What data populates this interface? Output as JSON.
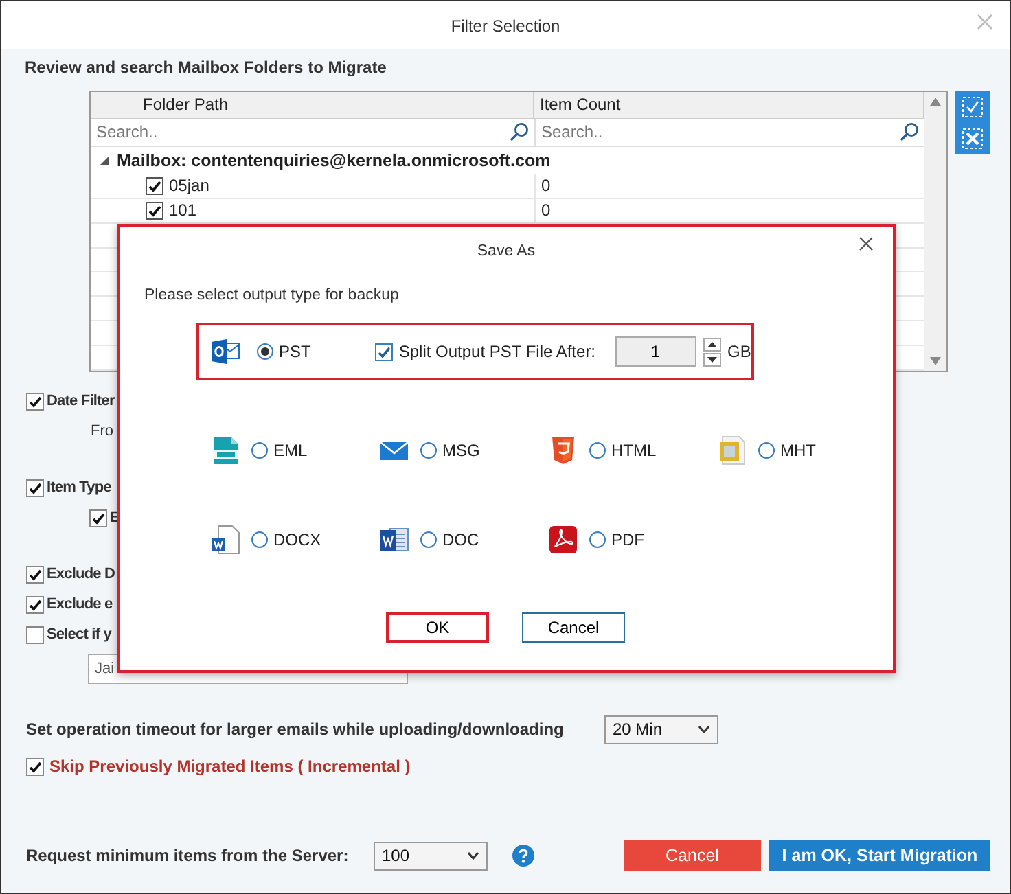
{
  "window": {
    "title": "Filter Selection"
  },
  "heading": "Review and search Mailbox Folders to Migrate",
  "folder_table": {
    "columns": [
      "Folder Path",
      "Item Count"
    ],
    "search_placeholders": [
      "Search..",
      "Search.."
    ],
    "mailbox": {
      "label": "Mailbox: contentenquiries@kernela.onmicrosoft.com",
      "expanded": true
    },
    "rows": [
      {
        "name": "05jan",
        "count": "0",
        "checked": true
      },
      {
        "name": "101",
        "count": "0",
        "checked": true
      }
    ]
  },
  "option_groups": [
    [
      {
        "kind": "check",
        "label": "Date Filter",
        "checked": true
      },
      {
        "kind": "text",
        "label": "Fro"
      }
    ],
    [
      {
        "kind": "check",
        "label": "Item Type",
        "checked": true
      },
      {
        "kind": "subcheck",
        "label": "E",
        "checked": true
      }
    ],
    [
      {
        "kind": "check",
        "label": "Exclude D",
        "checked": true
      },
      {
        "kind": "check",
        "label": "Exclude e",
        "checked": true
      },
      {
        "kind": "check",
        "label": "Select if y",
        "checked": false
      },
      {
        "kind": "field",
        "value": "Jai"
      }
    ]
  ],
  "timeout": {
    "label": "Set operation timeout for larger emails while uploading/downloading",
    "value": "20 Min"
  },
  "skip": {
    "label": "Skip Previously Migrated Items ( Incremental )",
    "checked": true
  },
  "request": {
    "label": "Request minimum items from the Server:",
    "value": "100"
  },
  "buttons": {
    "cancel": "Cancel",
    "start": "I am OK, Start Migration"
  },
  "dialog": {
    "title": "Save As",
    "prompt": "Please select output type for backup",
    "pst": {
      "label": "PST",
      "selected": true,
      "split_label": "Split Output PST File After:",
      "split_checked": true,
      "value": "1",
      "unit": "GB"
    },
    "formats": [
      {
        "kind": "eml",
        "label": "EML",
        "selected": false
      },
      {
        "kind": "msg",
        "label": "MSG",
        "selected": false
      },
      {
        "kind": "html",
        "label": "HTML",
        "selected": false
      },
      {
        "kind": "mht",
        "label": "MHT",
        "selected": false
      },
      {
        "kind": "docx",
        "label": "DOCX",
        "selected": false
      },
      {
        "kind": "doc",
        "label": "DOC",
        "selected": false
      },
      {
        "kind": "pdf",
        "label": "PDF",
        "selected": false
      }
    ],
    "ok": "OK",
    "cancel": "Cancel"
  }
}
